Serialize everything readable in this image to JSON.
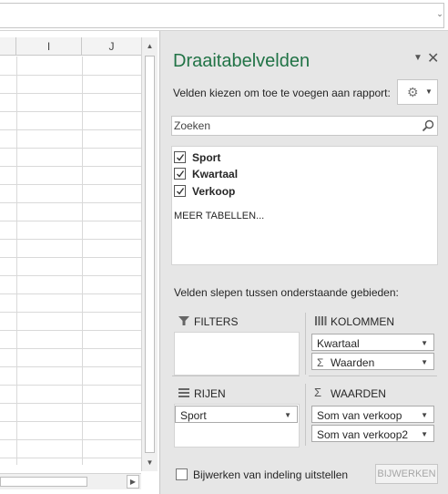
{
  "sheet": {
    "columns": [
      "I",
      "J"
    ]
  },
  "pane": {
    "title": "Draaitabelvelden",
    "choose_label": "Velden kiezen om toe te voegen aan rapport:",
    "search_placeholder": "Zoeken",
    "fields": [
      {
        "label": "Sport",
        "checked": true
      },
      {
        "label": "Kwartaal",
        "checked": true
      },
      {
        "label": "Verkoop",
        "checked": true
      }
    ],
    "more_tables": "MEER TABELLEN...",
    "drag_label": "Velden slepen tussen onderstaande gebieden:",
    "areas": {
      "filters": {
        "title": "FILTERS",
        "items": []
      },
      "columns": {
        "title": "KOLOMMEN",
        "items": [
          "Kwartaal",
          "Waarden"
        ]
      },
      "rows": {
        "title": "RIJEN",
        "items": [
          "Sport"
        ]
      },
      "values": {
        "title": "WAARDEN",
        "items": [
          "Som van verkoop",
          "Som van verkoop2"
        ]
      }
    },
    "defer_label": "Bijwerken van indeling uitstellen",
    "update_button": "BIJWERKEN",
    "accent_color": "#217346"
  }
}
